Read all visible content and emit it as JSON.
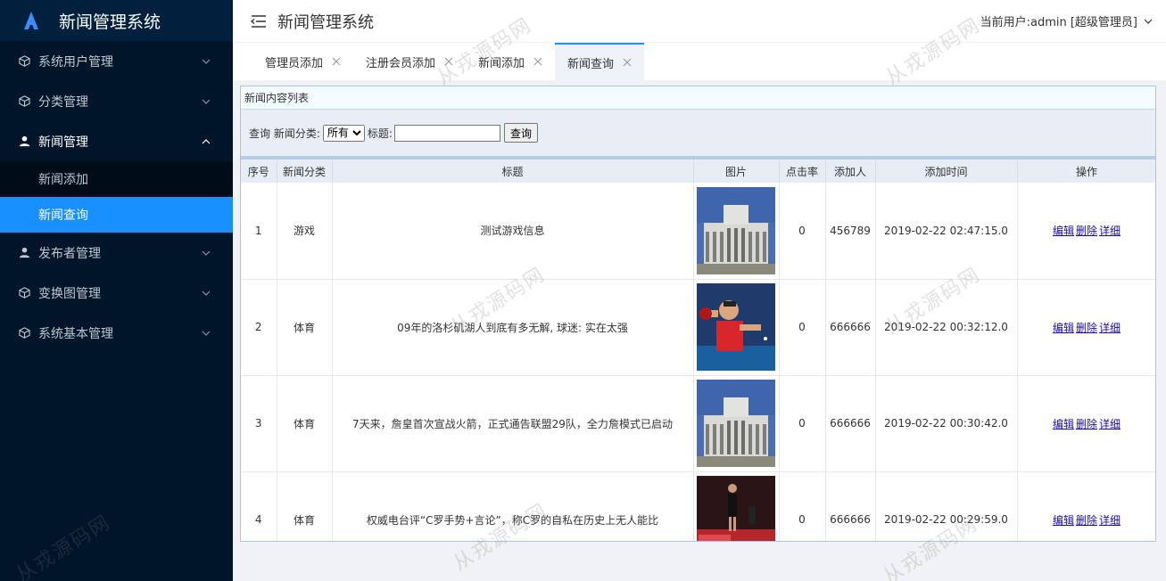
{
  "app": {
    "title": "新闻管理系统"
  },
  "header": {
    "title": "新闻管理系统",
    "user": "当前用户:admin [超级管理员]"
  },
  "sidebar": {
    "items": [
      {
        "label": "系统用户管理",
        "icon": "cube-icon"
      },
      {
        "label": "分类管理",
        "icon": "cube-icon"
      },
      {
        "label": "新闻管理",
        "icon": "user-icon",
        "open": true,
        "children": [
          {
            "label": "新闻添加"
          },
          {
            "label": "新闻查询",
            "active": true
          }
        ]
      },
      {
        "label": "发布者管理",
        "icon": "user-icon"
      },
      {
        "label": "变换图管理",
        "icon": "cube-icon"
      },
      {
        "label": "系统基本管理",
        "icon": "cube-icon"
      }
    ]
  },
  "tabs": [
    {
      "label": "管理员添加"
    },
    {
      "label": "注册会员添加"
    },
    {
      "label": "新闻添加"
    },
    {
      "label": "新闻查询",
      "active": true
    }
  ],
  "panel": {
    "title": "新闻内容列表",
    "query": {
      "prefix": "查询",
      "category_label": "新闻分类:",
      "category_value": "所有",
      "title_label": "标题:",
      "title_value": "",
      "button": "查询"
    }
  },
  "table": {
    "columns": [
      "序号",
      "新闻分类",
      "标题",
      "图片",
      "点击率",
      "添加人",
      "添加时间",
      "操作"
    ],
    "rows": [
      {
        "no": "1",
        "category": "游戏",
        "title": "测试游戏信息",
        "image": "building",
        "clicks": "0",
        "author": "456789",
        "time": "2019-02-22 02:47:15.0"
      },
      {
        "no": "2",
        "category": "体育",
        "title": "09年的洛杉矶湖人到底有多无解, 球迷: 实在太强",
        "image": "pingpong",
        "clicks": "0",
        "author": "666666",
        "time": "2019-02-22 00:32:12.0"
      },
      {
        "no": "3",
        "category": "体育",
        "title": "7天来，詹皇首次宣战火箭，正式通告联盟29队，全力詹模式已启动",
        "image": "building",
        "clicks": "0",
        "author": "666666",
        "time": "2019-02-22 00:30:42.0"
      },
      {
        "no": "4",
        "category": "体育",
        "title": "权威电台评“C罗手势+言论”，称C罗的自私在历史上无人能比",
        "image": "soccer",
        "clicks": "0",
        "author": "666666",
        "time": "2019-02-22 00:29:59.0"
      }
    ],
    "actions": {
      "edit": "编辑",
      "delete": "删除",
      "detail": "详细"
    }
  },
  "watermark": "从戎源码网",
  "colors": {
    "sidebar_bg": "#001529",
    "accent": "#1890ff"
  }
}
